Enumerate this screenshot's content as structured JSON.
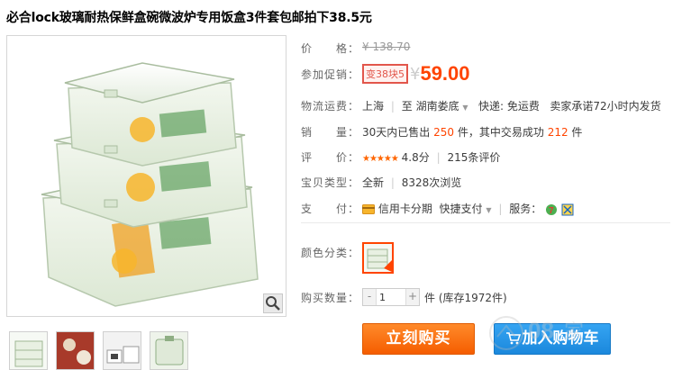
{
  "title": "必合lock玻璃耐热保鲜盒碗微波炉专用饭盒3件套包邮拍下38.5元",
  "price": {
    "label": "价　　格：",
    "original": "¥ 138.70"
  },
  "promo": {
    "label": "参加促销：",
    "tag": "变38块5",
    "currency": "¥",
    "value": "59.00"
  },
  "shipping": {
    "label": "物流运费：",
    "from": "上海",
    "to_word": "至",
    "destination": "湖南娄底",
    "express": "快递: 免运费",
    "promise": "卖家承诺72小时内发货"
  },
  "sales": {
    "label": "销　　量：",
    "prefix": "30天内已售出",
    "count": "250",
    "mid": "件，其中交易成功",
    "success": "212",
    "unit": "件"
  },
  "rating": {
    "label": "评　　价：",
    "score": "4.8分",
    "reviews": "215条评价",
    "stars": 5
  },
  "item_type": {
    "label": "宝贝类型：",
    "condition": "全新",
    "views": "8328次浏览"
  },
  "payment": {
    "label": "支　　付：",
    "installment": "信用卡分期",
    "quick": "快捷支付",
    "service_label": "服务："
  },
  "color": {
    "label": "颜色分类："
  },
  "quantity": {
    "label": "购买数量：",
    "value": "1",
    "stock": "件 (库存1972件)"
  },
  "buttons": {
    "buy": "立刻购买",
    "cart": "加入购物车"
  },
  "colors": {
    "accent": "#ff4400",
    "buy": "#f55d00",
    "cart": "#1b88dc",
    "promo_border": "#e2564b"
  }
}
